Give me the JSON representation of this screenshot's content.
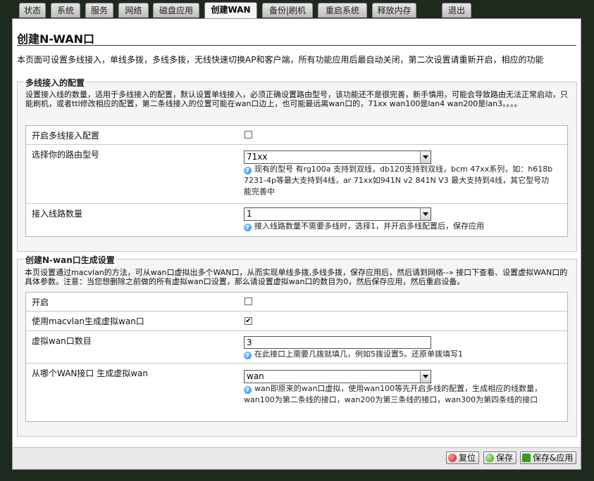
{
  "tabs": [
    {
      "label": "状态",
      "active": false
    },
    {
      "label": "系统",
      "active": false
    },
    {
      "label": "服务",
      "active": false
    },
    {
      "label": "网络",
      "active": false
    },
    {
      "label": "磁盘应用",
      "active": false
    },
    {
      "label": "创建WAN",
      "active": true
    },
    {
      "label": "备份|刷机",
      "active": false
    },
    {
      "label": "重启系统",
      "active": false
    },
    {
      "label": "释放内存",
      "active": false
    },
    {
      "label": "退出",
      "active": false
    }
  ],
  "page": {
    "title": "创建N-WAN口",
    "description": "本页面可设置多线接入，单线多拨，多线多拨，无线快速切换AP和客户端，所有功能应用后最自动关闭，第二次设置请重新开启，相应的功能"
  },
  "multi_line": {
    "legend": "多线接入的配置",
    "description": "设置接入线的数量，适用于多线接入的配置，默认设置单线接入，必须正确设置路由型号，该功能还不是很完善，新手慎用，可能会导致路由无法正常启动，只能刷机，或者ttl修改相应的配置，第二条线接入的位置可能在wan口边上，也可能最远离wan口的，71xx wan100是lan4 wan200是lan3。。。。",
    "enable_label": "开启多线接入配置",
    "enable_checked": false,
    "router_model_label": "选择你的路由型号",
    "router_model_value": "71xx",
    "router_model_hint": "现有的型号 有rg100a 支持到双线，db120支持到双线，bcm 47xx系列，如：h618b 7231-4p等最大支持到4线，ar 71xx如941N v2 841N V3 最大支持到4线，其它型号功能完善中",
    "line_count_label": "接入线路数量",
    "line_count_value": "1",
    "line_count_hint": "接入线路数量不需要多线时，选择1，并开启多线配置后，保存应用"
  },
  "nwan": {
    "legend": "创建N-wan口生成设置",
    "description": "本页设置通过macvlan的方法，可从wan口虚拟出多个WAN口，从而实现单线多拨,多线多拨，保存应用后，然后请到网络--» 接口下查看、设置虚拟WAN口的具体参数。注意：当您想删除之前做的所有虚拟wan口设置，那么请设置虚拟wan口的数目为0，然后保存应用，然后重启设备。",
    "enable_label": "开启",
    "enable_checked": false,
    "macvlan_label": "使用macvlan生成虚拟wan口",
    "macvlan_checked": true,
    "vwan_count_label": "虚拟wan口数目",
    "vwan_count_value": "3",
    "vwan_count_hint": "在此接口上需要几拨就填几，例如5拨设置5。还原单拨填写1",
    "source_label": "从哪个WAN接口 生成虚拟wan",
    "source_value": "wan",
    "source_hint": "wan即原来的wan口虚拟，使用wan100等先开启多线的配置，生成相应的线数量，wan100为第二条线的接口，wan200为第三条线的接口，wan300为第四条线的接口"
  },
  "buttons": {
    "reset": "复位",
    "save": "保存",
    "save_apply": "保存&应用"
  },
  "checkmark": "✔",
  "help_glyph": "?"
}
